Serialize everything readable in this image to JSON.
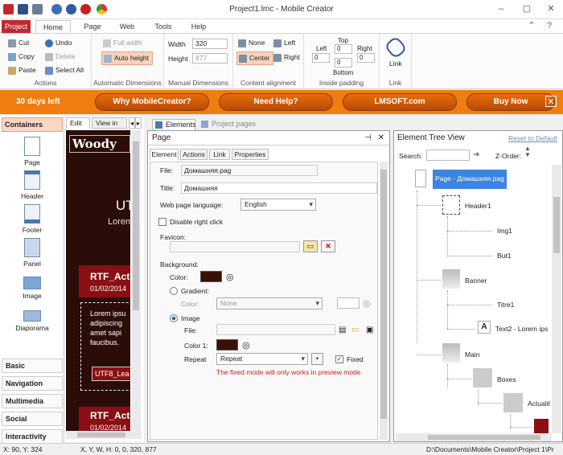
{
  "window": {
    "title": "Project1.lmc - Mobile Creator"
  },
  "ribbon_tabs": [
    "Project",
    "Home",
    "Page",
    "Web",
    "Tools",
    "Help"
  ],
  "ribbon": {
    "actions": {
      "cut": "Cut",
      "copy": "Copy",
      "paste": "Paste",
      "undo": "Undo",
      "delete": "Delete",
      "select_all": "Select All",
      "label": "Actions"
    },
    "auto_dim": {
      "full_width": "Full width",
      "auto_height": "Auto height",
      "label": "Automatic Dimensions"
    },
    "manual_dim": {
      "width_label": "Width",
      "width_value": "320",
      "height_label": "Height",
      "height_value": "877",
      "label": "Manual Dimensions"
    },
    "content_align": {
      "none": "None",
      "left": "Left",
      "center": "Center",
      "right": "Right",
      "label": "Content alignment"
    },
    "inside_padding": {
      "top": "Top",
      "left": "Left",
      "right": "Right",
      "bottom": "Bottom",
      "top_val": "0",
      "left_val": "0",
      "right_val": "0",
      "bottom_val": "0",
      "label": "Inside padding"
    },
    "link": {
      "button": "Link",
      "label": "Link"
    }
  },
  "promo": {
    "days_left": "30 days left",
    "buttons": [
      "Why MobileCreator?",
      "Need Help?",
      "LMSOFT.com",
      "Buy Now"
    ]
  },
  "palette": {
    "header": "Containers",
    "items": [
      "Page",
      "Header",
      "Footer",
      "Panel",
      "Image",
      "Diaporama"
    ],
    "categories": [
      "Basic",
      "Navigation",
      "Multimedia",
      "Social",
      "Interactivity"
    ]
  },
  "editor": {
    "tabs": [
      "Edit",
      "View in Int"
    ],
    "preview": {
      "logo": "Woody",
      "heading": "UTF",
      "sub": "Lorem",
      "card1_title": "RTF_Act",
      "card1_date": "01/02/2014",
      "body_lines": [
        "Lorem ipsu",
        "adipiscing",
        "amet sapi",
        "faucibus."
      ],
      "button": "UTF8_Lea",
      "card2_title": "RTF_Act",
      "card2_date": "01/02/2014"
    }
  },
  "mid_tabs": [
    "Elements",
    "Project pages"
  ],
  "page_panel": {
    "title": "Page",
    "tabs": [
      "Element",
      "Actions",
      "Link",
      "Properties"
    ],
    "file_label": "File:",
    "file_value": "Домашняя.pag",
    "title_label": "Title:",
    "title_value": "Домашняя",
    "lang_label": "Web page language:",
    "lang_value": "English",
    "disable_right_click": "Disable right click",
    "favicon_label": "Favicon:",
    "background_label": "Background:",
    "color_label": "Color:",
    "gradient_label": "Gradient:",
    "gradient_color_label": "Color:",
    "gradient_value": "None",
    "image_label": "Image",
    "image_file_label": "File:",
    "color1_label": "Color 1:",
    "repeat_label": "Repeat",
    "repeat_value": "Repeat",
    "fixed_label": "Fixed",
    "fixed_note": "The fixed mode will only works in preview mode"
  },
  "tree": {
    "title": "Element Tree View",
    "reset": "Reset to Default",
    "search_label": "Search:",
    "zorder_label": "Z-Order:",
    "nodes": [
      "Page - Домашняя.pag",
      "Header1",
      "Img1",
      "But1",
      "Banner",
      "Titre1",
      "Text2 - Lorem ips",
      "Main",
      "Boxes",
      "Actualit"
    ]
  },
  "status": {
    "coords": "X: 90, Y: 324",
    "xywh": "X, Y, W, H: 0, 0, 320, 877",
    "path": "D:\\Documents\\Mobile Creator\\Project 1\\Pr"
  }
}
